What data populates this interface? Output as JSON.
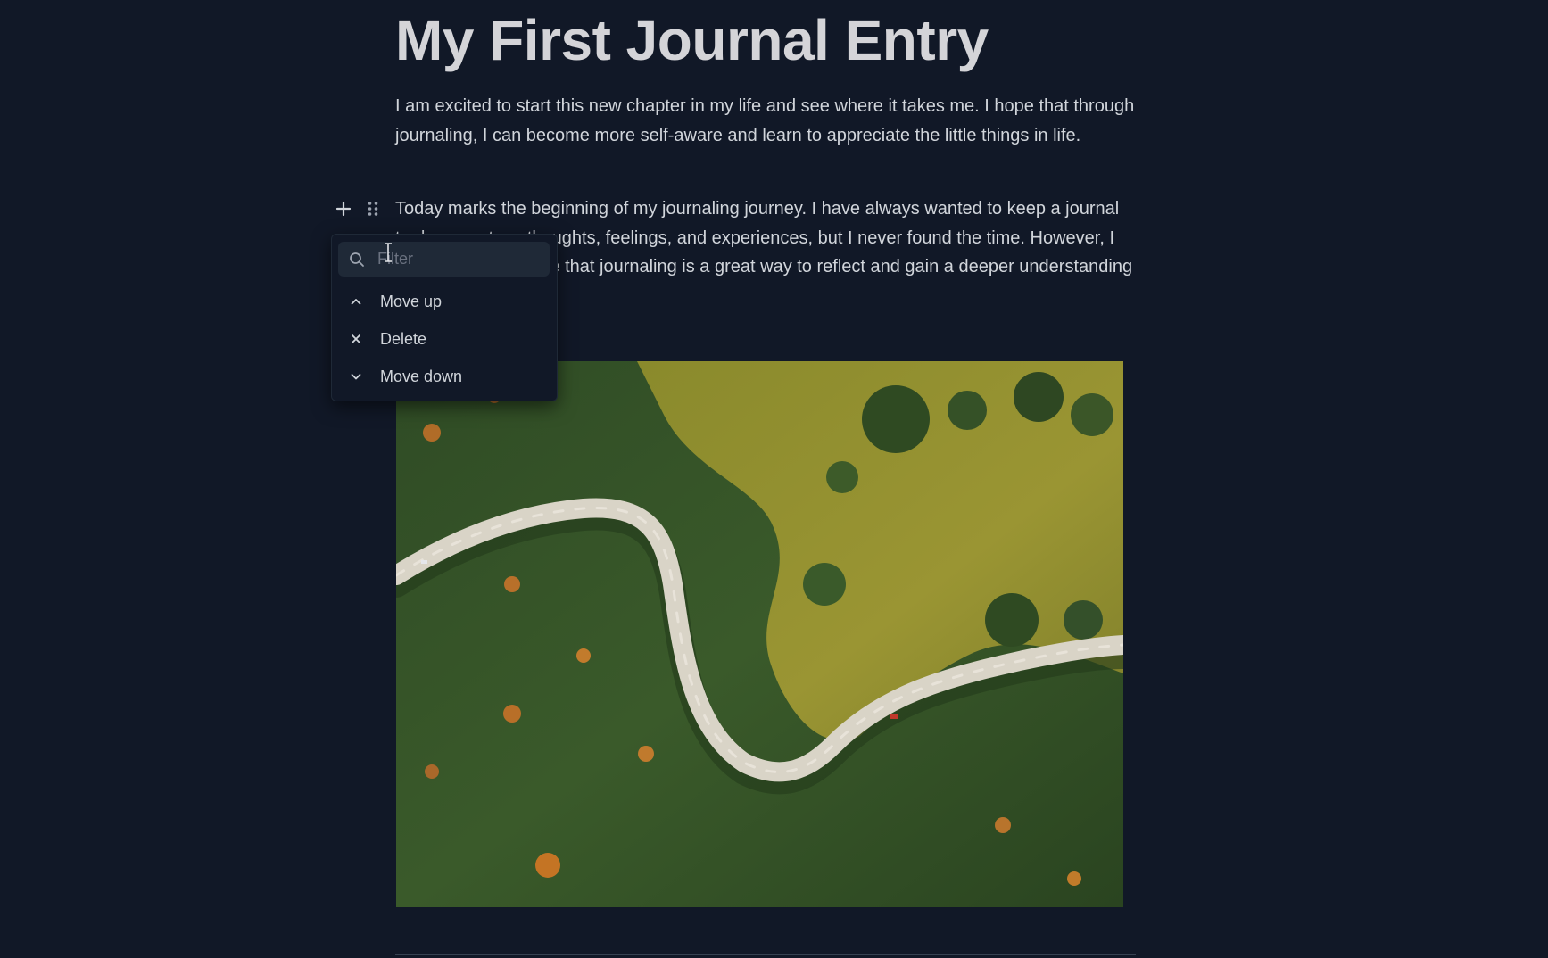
{
  "document": {
    "title": "My First Journal Entry",
    "paragraphs": [
      "I am excited to start this new chapter in my life and see where it takes me. I hope that through journaling, I can become more self-aware and learn to appreciate the little things in life.",
      "Today marks the beginning of my journaling journey. I have always wanted to keep a journal to document my thoughts, feelings, and experiences, but I never found the time. However, I have come to realize that journaling is a great way to reflect and gain a deeper understanding of myself."
    ]
  },
  "block_menu": {
    "filter_placeholder": "Filter",
    "filter_value": "",
    "items": [
      {
        "label": "Move up",
        "icon": "chevron-up-icon"
      },
      {
        "label": "Delete",
        "icon": "close-icon"
      },
      {
        "label": "Move down",
        "icon": "chevron-down-icon"
      }
    ]
  },
  "image": {
    "subject": "aerial-road-forest-photo"
  },
  "colors": {
    "background": "#111827",
    "menu_background": "#111827",
    "filter_background": "#1f2937",
    "title": "#d4d4d8",
    "body_text": "#d1d5db"
  }
}
